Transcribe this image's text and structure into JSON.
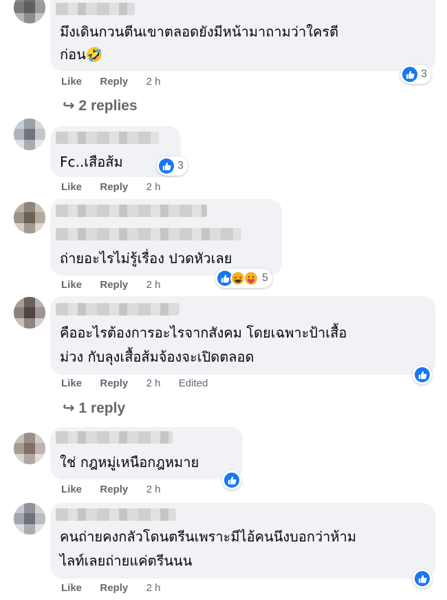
{
  "comments": [
    {
      "lines": [
        "มึงเดินกวนตีนเขาตลอดยังมีหน้ามาถามว่าใครตี",
        "ก่อน🤣"
      ],
      "like": "Like",
      "reply": "Reply",
      "time": "2 h",
      "reactions": {
        "types": [
          "like"
        ],
        "count": "3"
      },
      "replies_link": "↪ 2 replies"
    },
    {
      "lines": [
        "Fc..เสือส้ม"
      ],
      "like": "Like",
      "reply": "Reply",
      "time": "2 h",
      "reactions": {
        "types": [
          "like"
        ],
        "count": "3"
      }
    },
    {
      "lines": [
        "ถ่ายอะไรไม่รู้เรื่อง ปวดหัวเลย"
      ],
      "like": "Like",
      "reply": "Reply",
      "time": "2 h",
      "reactions": {
        "types": [
          "like",
          "haha",
          "care"
        ],
        "count": "5"
      }
    },
    {
      "lines": [
        "คืออะไรต้องการอะไรจากสังคม โดยเฉพาะป้าเสื้อ",
        "ม่วง กับลุงเสื้อส้มจ้องจะเปิดตลอด"
      ],
      "like": "Like",
      "reply": "Reply",
      "time": "2 h",
      "edited": "Edited",
      "reactions": {
        "types": [
          "like"
        ],
        "count": ""
      },
      "replies_link": "↪ 1 reply"
    },
    {
      "lines": [
        "ใช่ กฎหมู่เหนือกฎหมาย"
      ],
      "like": "Like",
      "reply": "Reply",
      "time": "2 h",
      "reactions": {
        "types": [
          "like"
        ],
        "count": ""
      }
    },
    {
      "lines": [
        "คนถ่ายคงกลัวโดนตรีนเพราะมีไอ้คนนึงบอกว่าห้าม",
        "ไลท์เลยถ่ายแค่ตรีนนน"
      ],
      "like": "Like",
      "reply": "Reply",
      "time": "2 h",
      "reactions": {
        "types": [
          "like"
        ],
        "count": ""
      }
    }
  ],
  "icons": {
    "like": "thumbs-up-icon",
    "haha": "laughing-face-icon",
    "care": "care-face-icon"
  },
  "colors": {
    "like_blue": "#1877f2",
    "bubble_bg": "#f0f2f5",
    "meta_gray": "#65676b"
  }
}
